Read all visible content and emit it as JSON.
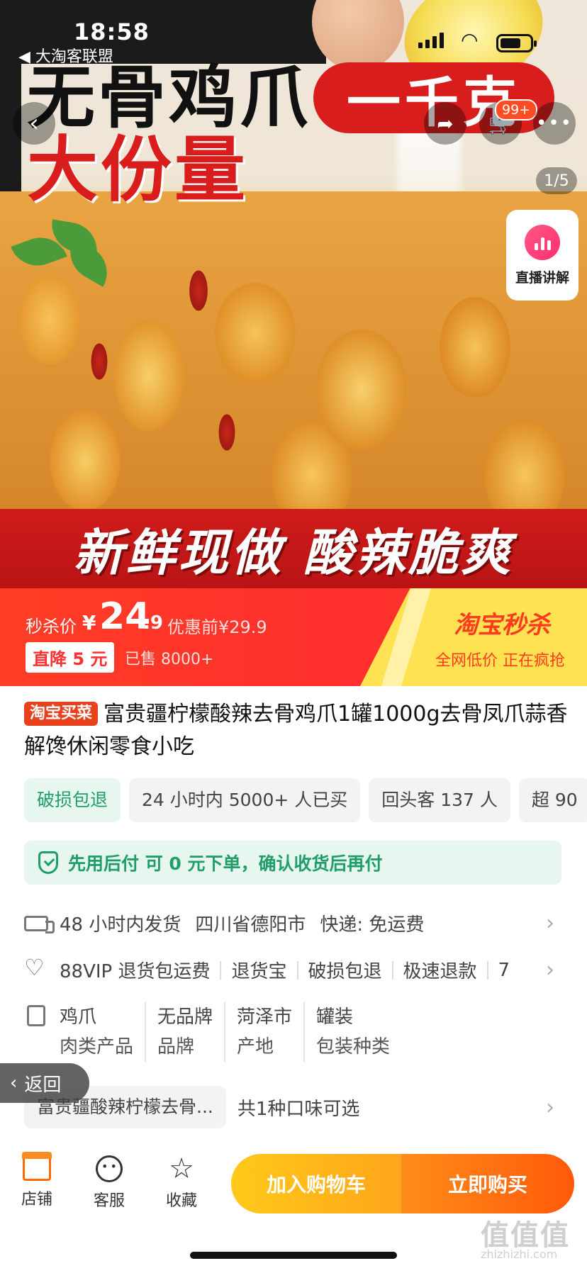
{
  "status_bar": {
    "time": "18:58",
    "back_app": "◀ 大淘客联盟"
  },
  "hero": {
    "title_line1": "无骨鸡爪",
    "title_line2": "大份量",
    "pill": "一千克",
    "banner": "新鲜现做 酸辣脆爽",
    "image_counter": "1/5",
    "cart_badge": "99+",
    "live_label": "直播讲解"
  },
  "price": {
    "label": "秒杀价",
    "currency": "¥",
    "integer": "24",
    "decimal": ".9",
    "original": "优惠前¥29.9",
    "drop_badge": "直降 5 元",
    "sold": "已售 8000+",
    "flash_logo": "淘宝秒杀",
    "flash_sub": "全网低价 正在疯抢"
  },
  "product": {
    "tag": "淘宝买菜",
    "title": "富贵疆柠檬酸辣去骨鸡爪1罐1000g去骨凤爪蒜香解馋休闲零食小吃"
  },
  "chips": [
    "破损包退",
    "24 小时内 5000+ 人已买",
    "回头客 137 人",
    "超 90"
  ],
  "pay_later": "先用后付 可 0 元下单，确认收货后再付",
  "shipping": {
    "time": "48 小时内发货",
    "origin": "四川省德阳市",
    "express": "快递: 免运费"
  },
  "services": [
    "88VIP 退货包运费",
    "退货宝",
    "破损包退",
    "极速退款",
    "7"
  ],
  "specs": [
    {
      "value": "鸡爪",
      "key": "肉类产品"
    },
    {
      "value": "无品牌",
      "key": "品牌"
    },
    {
      "value": "菏泽市",
      "key": "产地"
    },
    {
      "value": "罐装",
      "key": "包装种类"
    }
  ],
  "return_btn": "返回",
  "flavor": {
    "selected": "富贵疆酸辣柠檬去骨...",
    "count": "共1种口味可选"
  },
  "bottom": {
    "shop": "店铺",
    "service": "客服",
    "favorite": "收藏",
    "add_cart": "加入购物车",
    "buy_now": "立即购买"
  },
  "watermark": {
    "main": "值值值",
    "sub": "zhizhizhi.com"
  },
  "colors": {
    "accent_red": "#ff2f2f",
    "accent_orange": "#ff6a00",
    "green": "#1f9e68",
    "flash_yellow": "#ffe251"
  }
}
